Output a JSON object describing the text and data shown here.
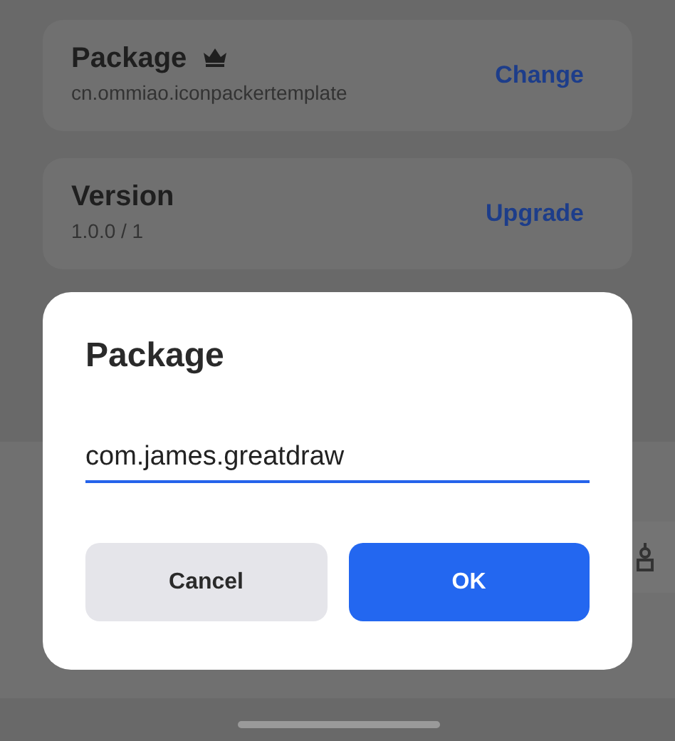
{
  "settings": [
    {
      "title": "Package",
      "premium": true,
      "value": "cn.ommiao.iconpackertemplate",
      "action": "Change"
    },
    {
      "title": "Version",
      "premium": false,
      "value": "1.0.0 / 1",
      "action": "Upgrade"
    }
  ],
  "dialog": {
    "title": "Package",
    "input": {
      "value": "com.james.greatdraw",
      "focused": true
    },
    "buttons": [
      {
        "label": "Cancel",
        "kind": "secondary"
      },
      {
        "label": "OK",
        "kind": "primary"
      }
    ]
  }
}
